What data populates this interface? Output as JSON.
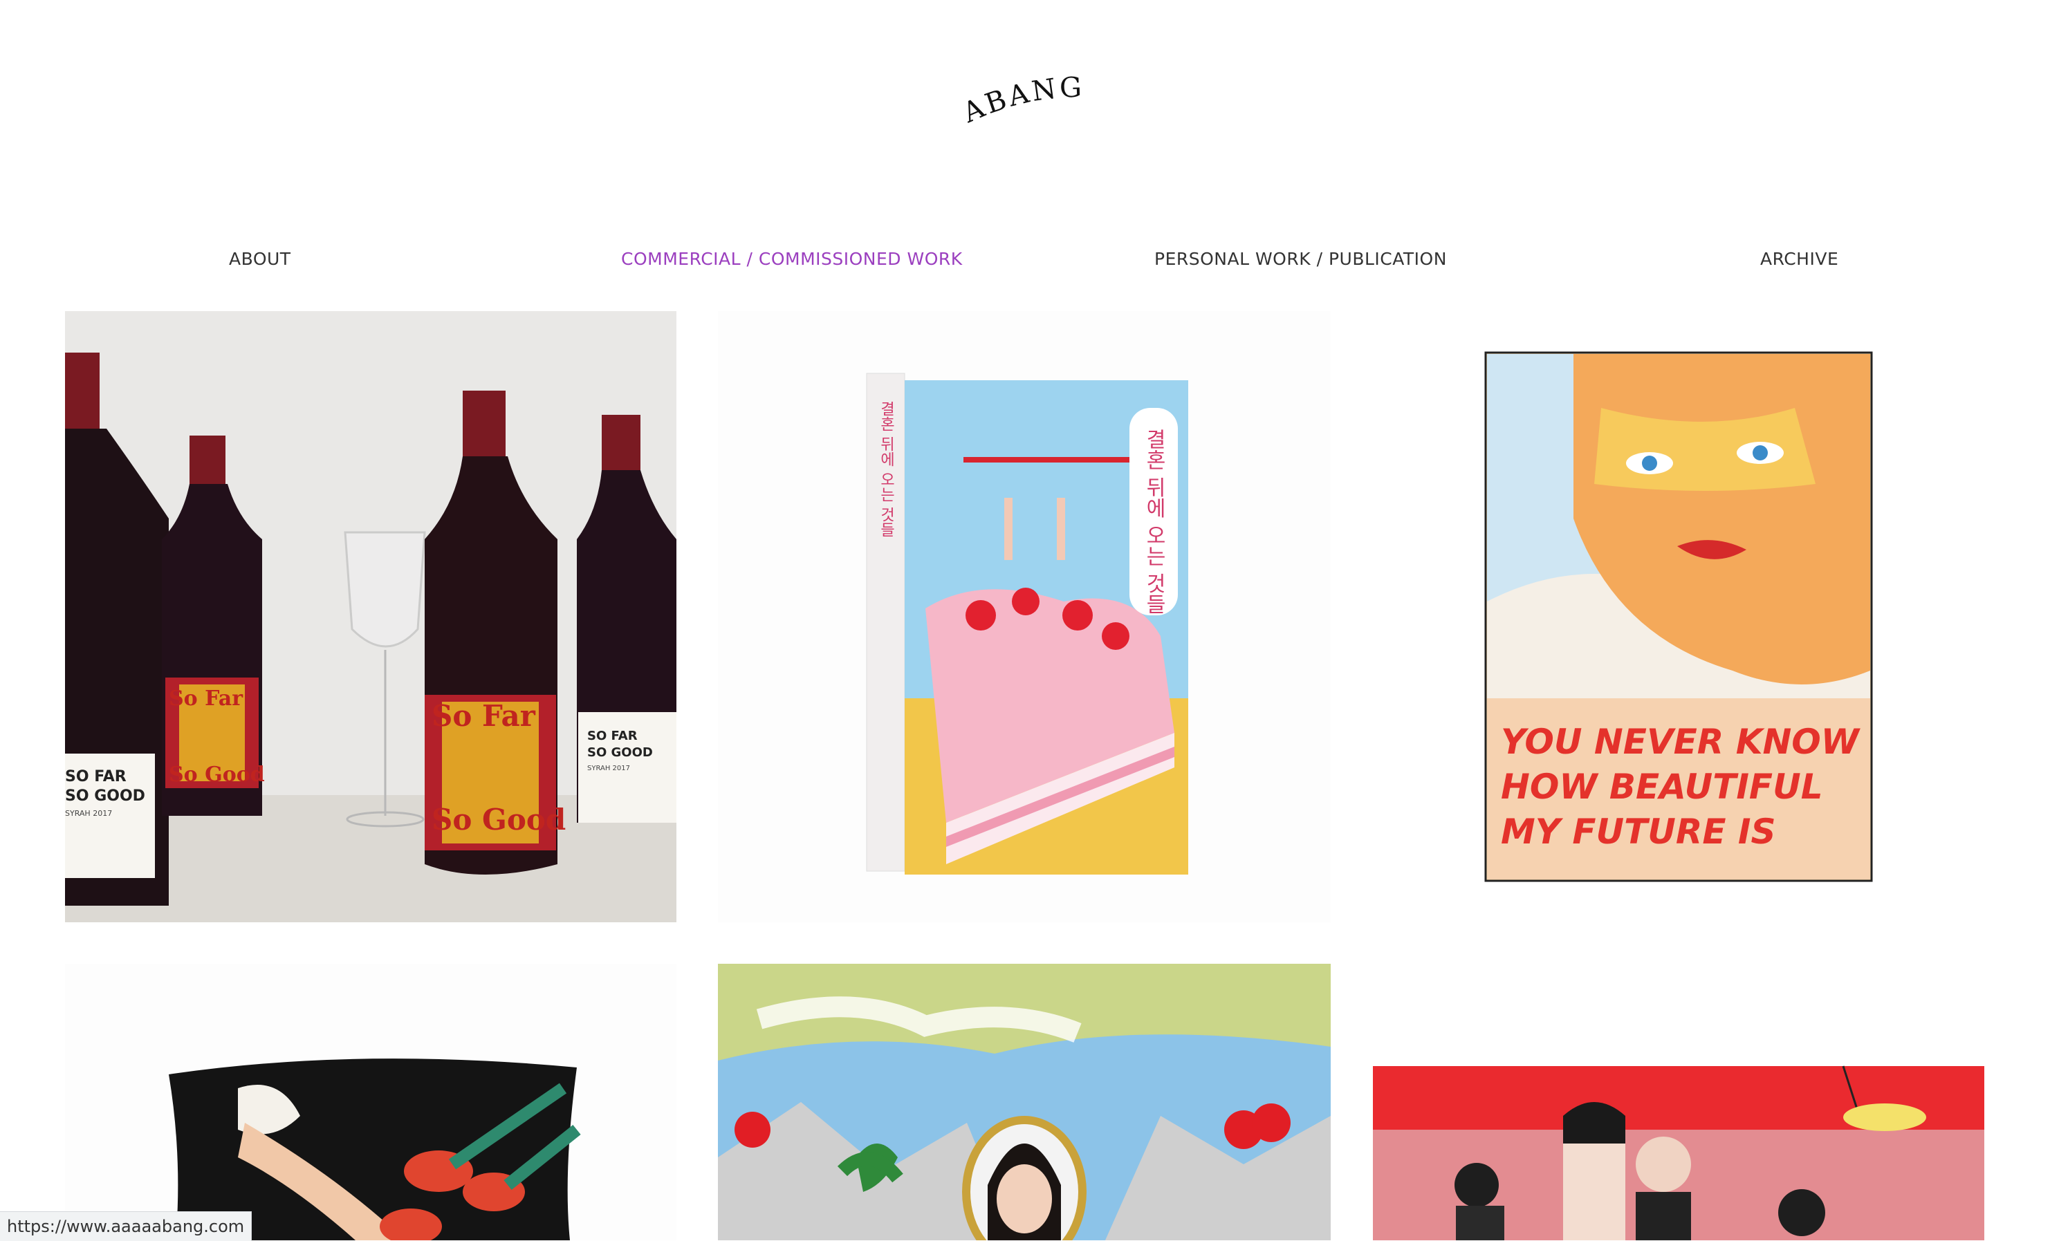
{
  "site": {
    "logo_text": "ABANG"
  },
  "nav": {
    "items": [
      {
        "label": "ABOUT"
      },
      {
        "label": "COMMERCIAL / COMMISSIONED WORK"
      },
      {
        "label": "PERSONAL WORK / PUBLICATION"
      },
      {
        "label": "ARCHIVE"
      }
    ],
    "active_color": "#9b3fbf"
  },
  "gallery": {
    "wine": {
      "label_a": "SO FAR",
      "label_b": "SO GOOD",
      "vintage": "SYRAH 2017",
      "art_text_1": "So Far",
      "art_text_2": "So Good"
    },
    "book": {
      "title_ko": "결혼 뒤에 오는 것들",
      "spine_ko": "결혼 뒤에 오는 것들"
    },
    "poster": {
      "line1": "YOU NEVER KNOW",
      "line2": "HOW BEAUTIFUL",
      "line3": "MY FUTURE IS"
    }
  },
  "status_bar": {
    "url": "https://www.aaaaabang.com"
  }
}
